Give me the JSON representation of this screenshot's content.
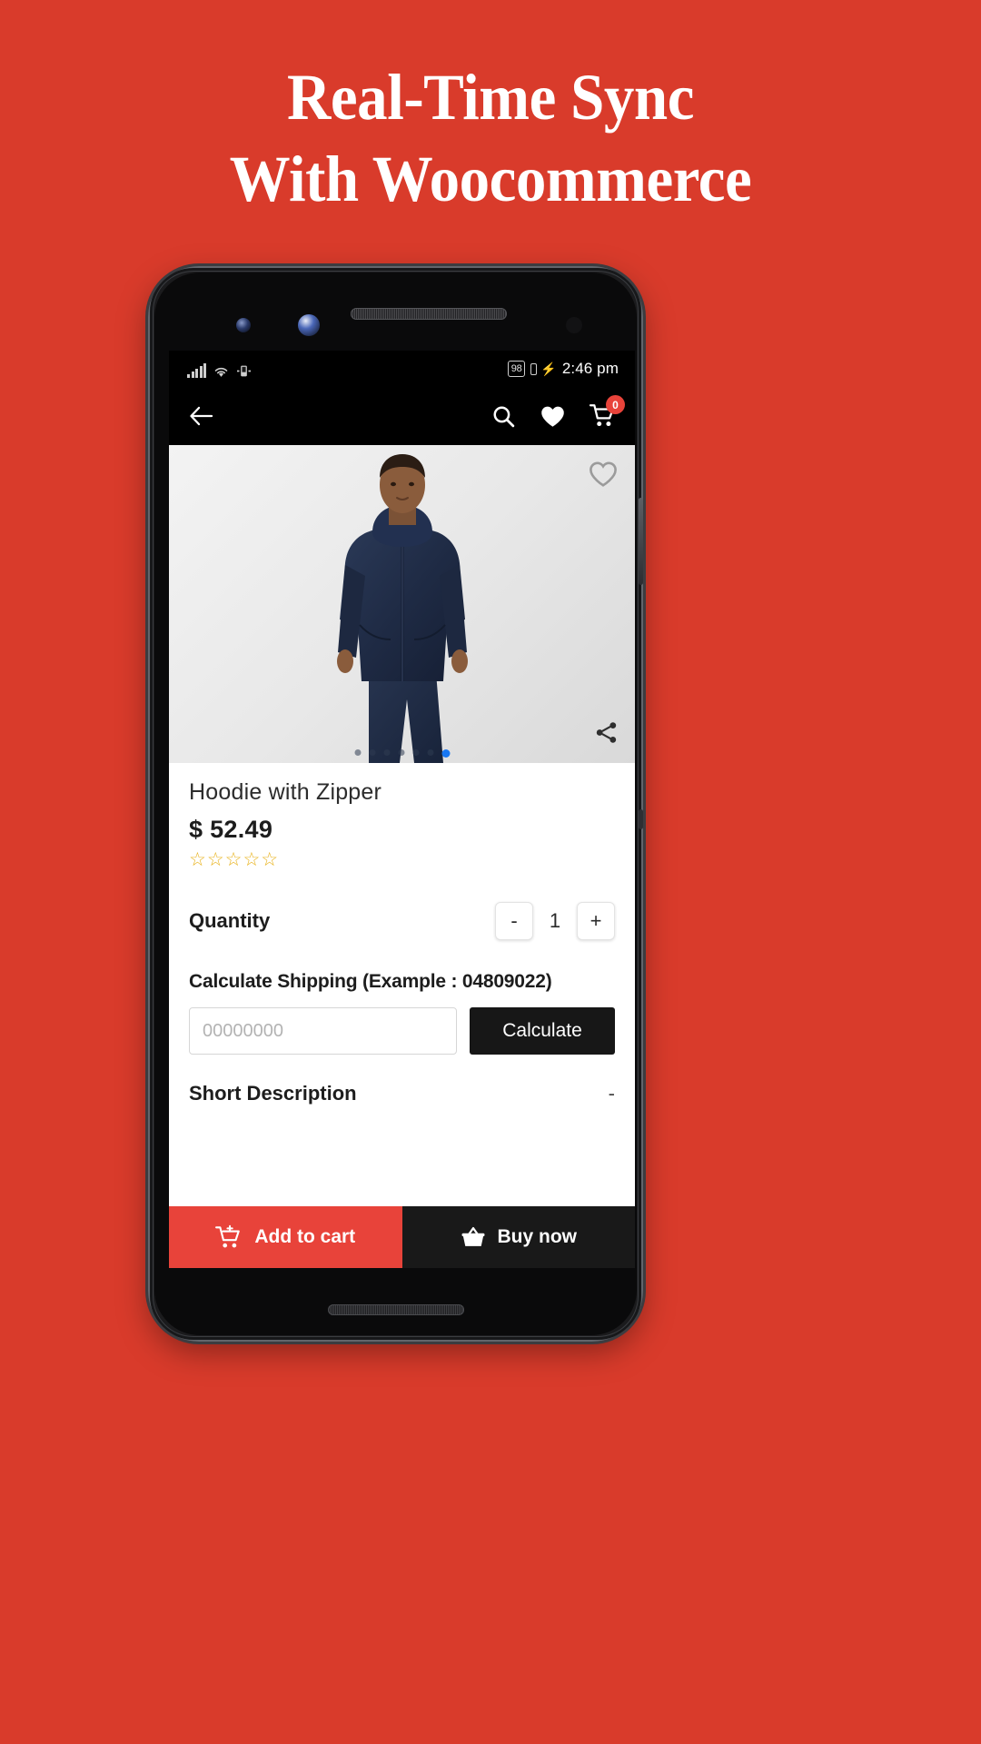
{
  "promo": {
    "line1": "Real-Time Sync",
    "line2": "With Woocommerce",
    "background_color": "#D93B2B",
    "text_color": "#FFFFFF"
  },
  "statusbar": {
    "signal_icon": "signal-bars-icon",
    "wifi_icon": "wifi-icon",
    "vibrate_icon": "vibrate-icon",
    "battery_percent": "98",
    "charging_icon": "bolt-icon",
    "time": "2:46 pm"
  },
  "appbar": {
    "back_icon": "back-arrow-icon",
    "search_icon": "search-icon",
    "wishlist_icon": "heart-icon",
    "cart_icon": "shopping-cart-icon",
    "cart_badge": "0",
    "badge_color": "#E8433A"
  },
  "gallery": {
    "wishlist_outline_icon": "heart-outline-icon",
    "share_icon": "share-icon",
    "dot_count": 7,
    "active_dot_index": 6,
    "active_dot_color": "#1877F2"
  },
  "product": {
    "title": "Hoodie with Zipper",
    "price": "$ 52.49",
    "rating_stars": "☆☆☆☆☆",
    "rating_color": "#E8B21C"
  },
  "quantity": {
    "label": "Quantity",
    "decrement_label": "-",
    "value": "1",
    "increment_label": "+"
  },
  "shipping": {
    "label": "Calculate Shipping (Example : 04809022)",
    "zip_value": "",
    "zip_placeholder": "00000000",
    "calculate_label": "Calculate"
  },
  "short_description": {
    "title": "Short Description",
    "toggle_label": "-"
  },
  "actionbar": {
    "add_to_cart_label": "Add to cart",
    "add_to_cart_icon": "add-to-cart-icon",
    "add_to_cart_color": "#E8433A",
    "buy_now_label": "Buy now",
    "buy_now_icon": "basket-icon",
    "buy_now_color": "#191919"
  }
}
